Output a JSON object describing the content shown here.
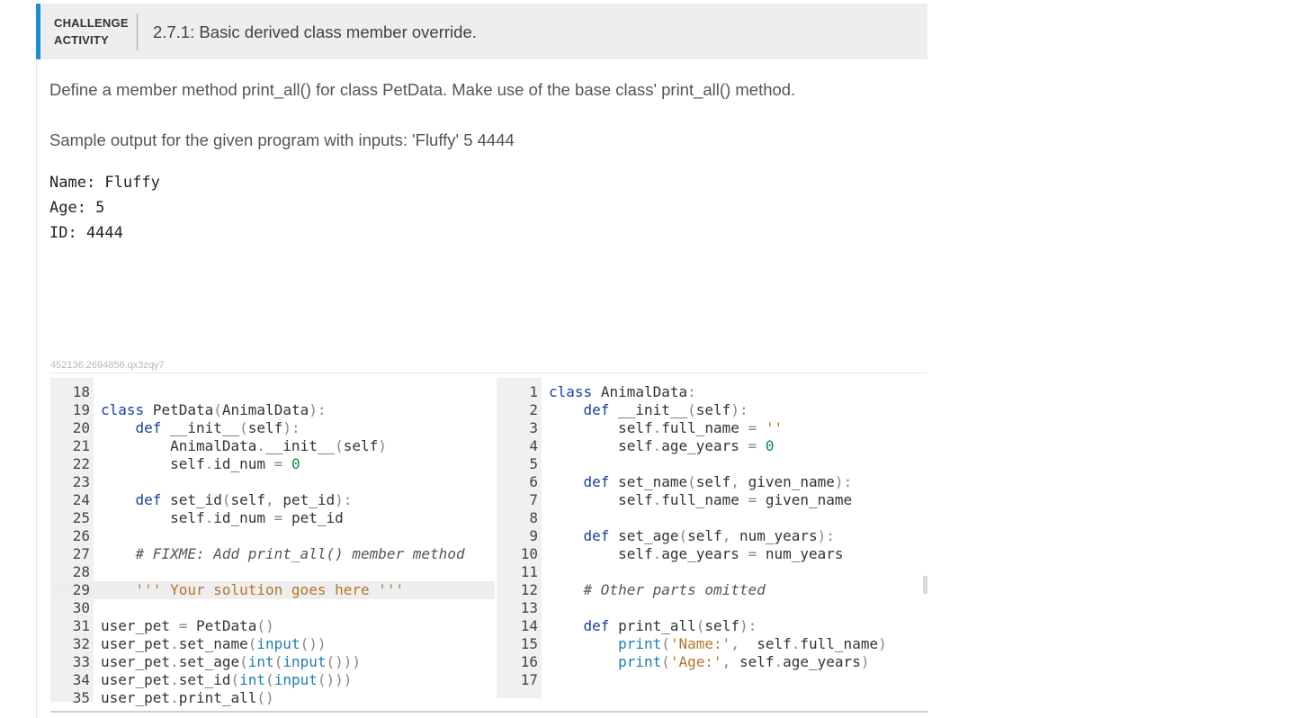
{
  "header": {
    "label_line1": "CHALLENGE",
    "label_line2": "ACTIVITY",
    "title": "2.7.1: Basic derived class member override."
  },
  "instructions": "Define a member method print_all() for class PetData. Make use of the base class' print_all() method.",
  "sample_intro": "Sample output for the given program with inputs: 'Fluffy' 5 4444",
  "sample_output": [
    "Name: Fluffy",
    "Age: 5",
    "ID: 4444"
  ],
  "activity_id": "452136.2694856.qx3zqy7",
  "colors": {
    "accent": "#1b8fd6",
    "header_bg": "#eeeeee",
    "keyword": "#1a3e9c",
    "string": "#b5742b",
    "number": "#0a8a3a"
  },
  "left_editor": {
    "lines": [
      {
        "n": "18",
        "code": ""
      },
      {
        "n": "19",
        "code": "class PetData(AnimalData):"
      },
      {
        "n": "20",
        "code": "    def __init__(self):"
      },
      {
        "n": "21",
        "code": "        AnimalData.__init__(self)"
      },
      {
        "n": "22",
        "code": "        self.id_num = 0"
      },
      {
        "n": "23",
        "code": ""
      },
      {
        "n": "24",
        "code": "    def set_id(self, pet_id):"
      },
      {
        "n": "25",
        "code": "        self.id_num = pet_id"
      },
      {
        "n": "26",
        "code": ""
      },
      {
        "n": "27",
        "code": "    # FIXME: Add print_all() member method"
      },
      {
        "n": "28",
        "code": ""
      },
      {
        "n": "29",
        "code": "    ''' Your solution goes here '''"
      },
      {
        "n": "30",
        "code": ""
      },
      {
        "n": "31",
        "code": "user_pet = PetData()"
      },
      {
        "n": "32",
        "code": "user_pet.set_name(input())"
      },
      {
        "n": "33",
        "code": "user_pet.set_age(int(input()))"
      },
      {
        "n": "34",
        "code": "user_pet.set_id(int(input()))"
      },
      {
        "n": "35",
        "code": "user_pet.print_all()"
      }
    ]
  },
  "right_editor": {
    "lines": [
      {
        "n": "1",
        "code": "class AnimalData:"
      },
      {
        "n": "2",
        "code": "    def __init__(self):"
      },
      {
        "n": "3",
        "code": "        self.full_name = ''"
      },
      {
        "n": "4",
        "code": "        self.age_years = 0"
      },
      {
        "n": "5",
        "code": ""
      },
      {
        "n": "6",
        "code": "    def set_name(self, given_name):"
      },
      {
        "n": "7",
        "code": "        self.full_name = given_name"
      },
      {
        "n": "8",
        "code": ""
      },
      {
        "n": "9",
        "code": "    def set_age(self, num_years):"
      },
      {
        "n": "10",
        "code": "        self.age_years = num_years"
      },
      {
        "n": "11",
        "code": ""
      },
      {
        "n": "12",
        "code": "    # Other parts omitted"
      },
      {
        "n": "13",
        "code": ""
      },
      {
        "n": "14",
        "code": "    def print_all(self):"
      },
      {
        "n": "15",
        "code": "        print('Name:',  self.full_name)"
      },
      {
        "n": "16",
        "code": "        print('Age:', self.age_years)"
      },
      {
        "n": "17",
        "code": ""
      }
    ]
  }
}
